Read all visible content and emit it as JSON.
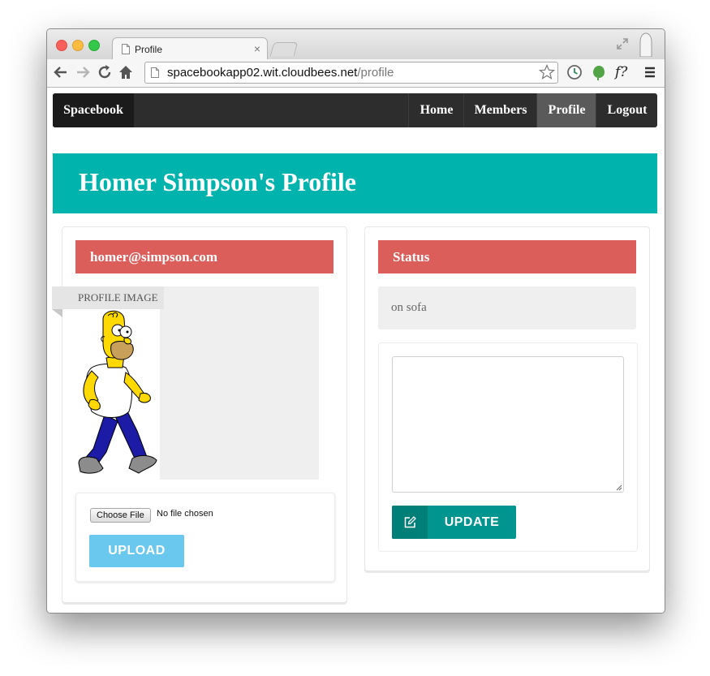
{
  "browser": {
    "tab_title": "Profile",
    "tab_close": "×",
    "url_host": "spacebookapp02.wit.cloudbees.net",
    "url_path": "/profile",
    "extension_fx": "f?"
  },
  "navbar": {
    "brand": "Spacebook",
    "items": [
      {
        "label": "Home",
        "active": false
      },
      {
        "label": "Members",
        "active": false
      },
      {
        "label": "Profile",
        "active": true
      },
      {
        "label": "Logout",
        "active": false
      }
    ]
  },
  "banner": {
    "title": "Homer Simpson's Profile"
  },
  "left_panel": {
    "email": "homer@simpson.com",
    "image_label": "PROFILE IMAGE",
    "choose_file_label": "Choose File",
    "file_status": "No file chosen",
    "upload_label": "UPLOAD"
  },
  "right_panel": {
    "header": "Status",
    "current_status": "on sofa",
    "textarea_value": "",
    "update_label": "UPDATE"
  },
  "colors": {
    "banner": "#00b3ac",
    "card_header": "#dc5e5b",
    "upload_button": "#6ac8ef",
    "update_button": "#00958e",
    "navbar": "#2d2d2d"
  }
}
